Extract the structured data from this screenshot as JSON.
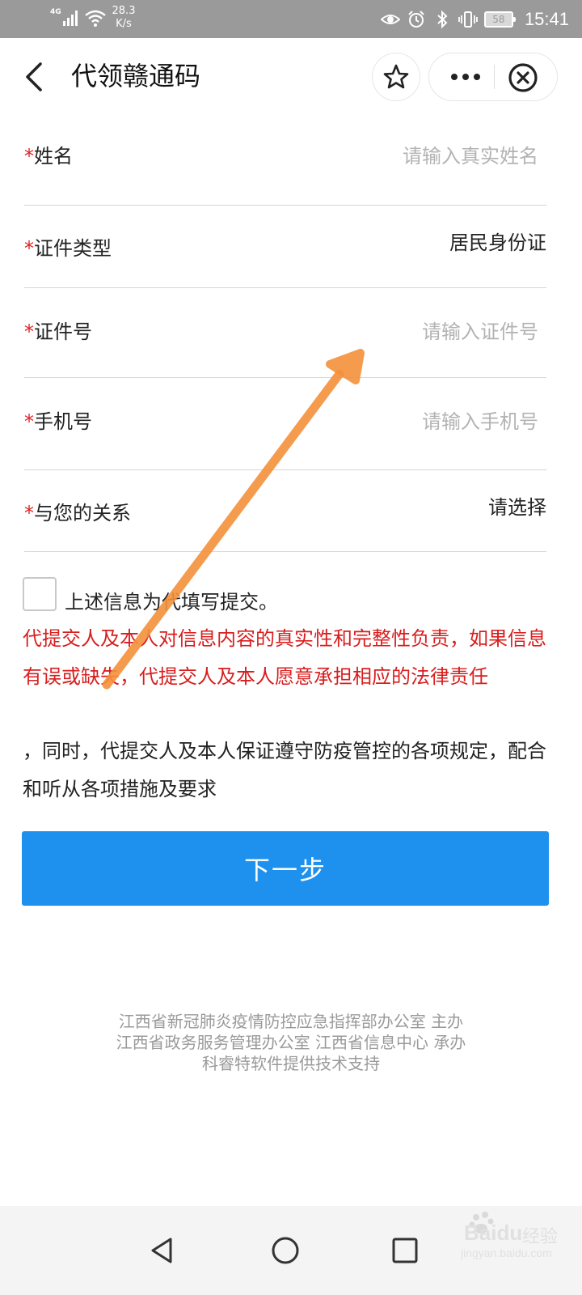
{
  "status_bar": {
    "network": "4G",
    "speed_value": "28.3",
    "speed_unit": "K/s",
    "battery": "58",
    "time": "15:41"
  },
  "header": {
    "title": "代领赣通码",
    "icons": [
      "back-arrow",
      "star",
      "more-dots",
      "close-circle"
    ]
  },
  "form": {
    "required_mark": "*",
    "fields": [
      {
        "label": "姓名",
        "placeholder": "请输入真实姓名"
      },
      {
        "label": "证件类型",
        "value": "居民身份证"
      },
      {
        "label": "证件号",
        "placeholder": "请输入证件号"
      },
      {
        "label": "手机号",
        "placeholder": "请输入手机号"
      },
      {
        "label": "与您的关系",
        "value": "请选择"
      }
    ]
  },
  "agreement": {
    "checkbox_label": "上述信息为代填写提交。",
    "warning": "代提交人及本人对信息内容的真实性和完整性负责，如果信息有误或缺失，代提交人及本人愿意承担相应的法律责任",
    "notice": "，同时，代提交人及本人保证遵守防疫管控的各项规定，配合和听从各项措施及要求"
  },
  "next_button": "下一步",
  "footer": [
    "江西省新冠肺炎疫情防控应急指挥部办公室 主办",
    "江西省政务服务管理办公室 江西省信息中心 承办",
    "科睿特软件提供技术支持"
  ],
  "watermark": {
    "brand": "Baidu",
    "suffix": "经验",
    "url": "jingyan.baidu.com"
  },
  "colors": {
    "primary": "#1e90ee",
    "warning": "#d81e1e",
    "annotation_arrow": "#f5913b",
    "status_bar": "#9a9a9a"
  }
}
